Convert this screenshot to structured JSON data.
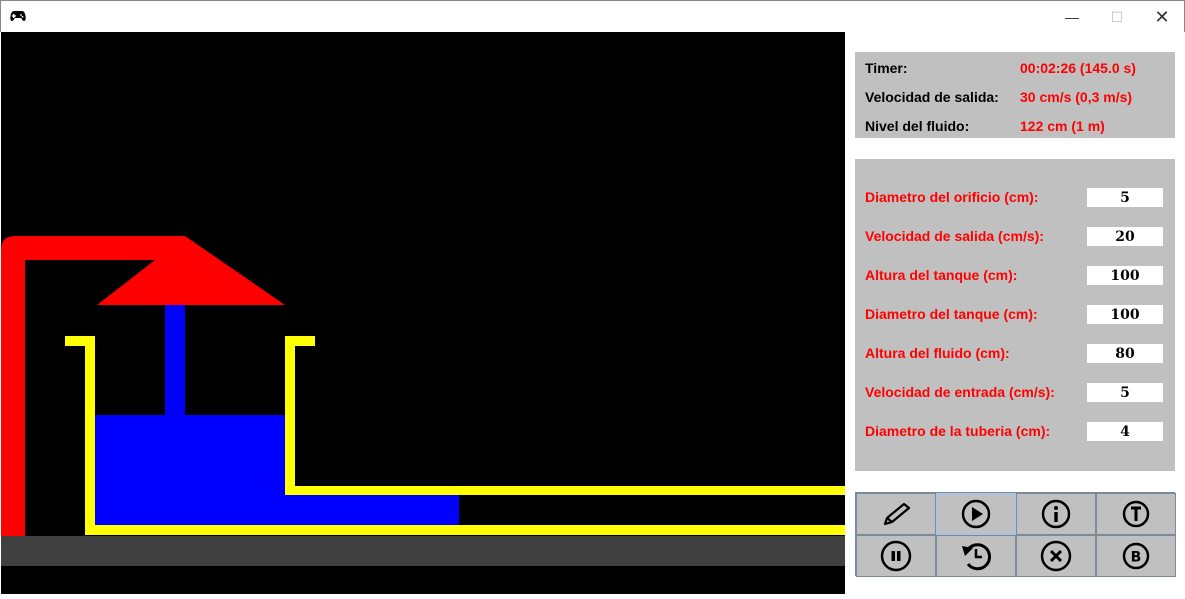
{
  "window": {
    "icon": "gamepad-icon",
    "controls": [
      "minimize",
      "maximize",
      "close"
    ]
  },
  "info": {
    "timer_label": "Timer:",
    "timer_value": "00:02:26 (145.0 s)",
    "vel_label": "Velocidad de salida:",
    "vel_value": "30 cm/s (0,3 m/s)",
    "level_label": "Nivel del fluido:",
    "level_value": "122 cm (1 m)"
  },
  "params": [
    {
      "label": "Diametro del orificio (cm):",
      "value": "5"
    },
    {
      "label": "Velocidad de salida (cm/s):",
      "value": "20"
    },
    {
      "label": "Altura del tanque (cm):",
      "value": "100"
    },
    {
      "label": "Diametro del tanque (cm):",
      "value": "100"
    },
    {
      "label": "Altura del fluido (cm):",
      "value": "80"
    },
    {
      "label": "Velocidad de entrada (cm/s):",
      "value": "5"
    },
    {
      "label": "Diametro de la tuberia (cm):",
      "value": "4"
    }
  ],
  "buttons": [
    "edit",
    "play",
    "info",
    "T",
    "pause",
    "restore",
    "cancel",
    "B"
  ],
  "colors": {
    "fluid": "#0000ff",
    "pipe": "#ff0000",
    "tank": "#ffff00",
    "floor": "#404040"
  }
}
